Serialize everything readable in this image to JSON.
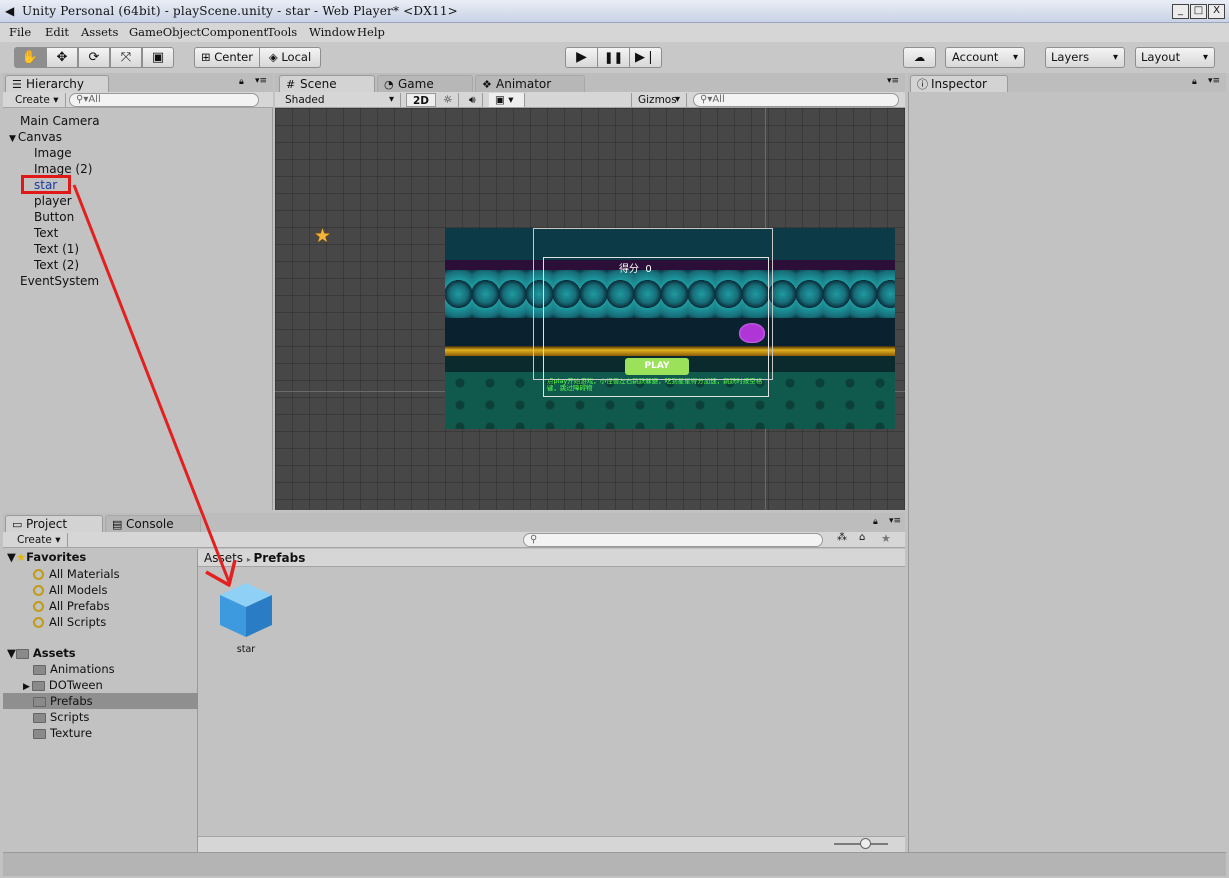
{
  "window": {
    "title": "Unity Personal (64bit) - playScene.unity - star - Web Player* <DX11>",
    "minimize": "_",
    "maximize": "□",
    "close": "X"
  },
  "menu": [
    "File",
    "Edit",
    "Assets",
    "GameObject",
    "Component",
    "Tools",
    "Window",
    "Help"
  ],
  "toolbar": {
    "tools": [
      "hand-icon",
      "move-icon",
      "rotate-icon",
      "scale-icon",
      "rect-icon"
    ],
    "center_label": "Center",
    "local_label": "Local",
    "account_label": "Account",
    "layers_label": "Layers",
    "layout_label": "Layout"
  },
  "hierarchy": {
    "tab_label": "Hierarchy",
    "create_label": "Create",
    "search_placeholder": "All",
    "items": [
      {
        "label": "Main Camera",
        "indent": 0
      },
      {
        "label": "Canvas",
        "indent": 0
      },
      {
        "label": "Image",
        "indent": 1
      },
      {
        "label": "Image (2)",
        "indent": 1
      },
      {
        "label": "star",
        "indent": 1
      },
      {
        "label": "player",
        "indent": 1
      },
      {
        "label": "Button",
        "indent": 1
      },
      {
        "label": "Text",
        "indent": 1
      },
      {
        "label": "Text (1)",
        "indent": 1
      },
      {
        "label": "Text (2)",
        "indent": 1
      },
      {
        "label": "EventSystem",
        "indent": 0
      }
    ]
  },
  "scene": {
    "tabs": [
      {
        "label": "Scene"
      },
      {
        "label": "Game"
      },
      {
        "label": "Animator"
      }
    ],
    "shading": "Shaded",
    "mode_2d": "2D",
    "gizmos": "Gizmos",
    "search_placeholder": "All",
    "score_text": "得分  0",
    "play_button": "PLAY",
    "hint_text": "点play开始游戏，小怪兽左右跳跃躲避，吃到星星得分加速，跳跃时按空格键，跳过障碍物"
  },
  "inspector": {
    "tab_label": "Inspector"
  },
  "project": {
    "tabs": [
      {
        "label": "Project"
      },
      {
        "label": "Console"
      }
    ],
    "create_label": "Create",
    "favorites_label": "Favorites",
    "favorites": [
      "All Materials",
      "All Models",
      "All Prefabs",
      "All Scripts"
    ],
    "assets_label": "Assets",
    "folders": [
      "Animations",
      "DOTween",
      "Prefabs",
      "Scripts",
      "Texture"
    ],
    "selected_folder": "Prefabs",
    "breadcrumb": [
      "Assets",
      "Prefabs"
    ],
    "asset_items": [
      {
        "label": "star"
      }
    ]
  },
  "colors": {
    "highlight": "#e01818",
    "arrow": "#e32020",
    "selected_row": "#8f8f8f"
  }
}
